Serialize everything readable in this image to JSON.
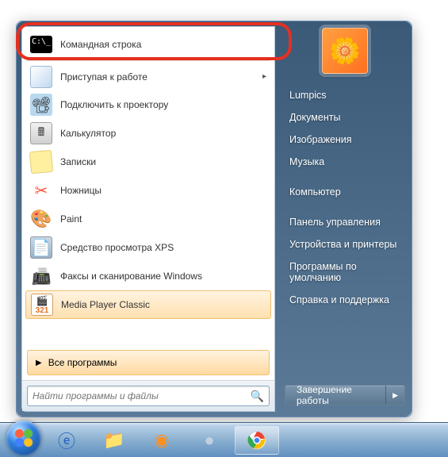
{
  "programs": [
    {
      "label": "Командная строка",
      "icon": "cmd"
    },
    {
      "label": "Приступая к работе",
      "icon": "start",
      "submenu": true
    },
    {
      "label": "Подключить к проектору",
      "icon": "proj"
    },
    {
      "label": "Калькулятор",
      "icon": "calc"
    },
    {
      "label": "Записки",
      "icon": "notes"
    },
    {
      "label": "Ножницы",
      "icon": "snip"
    },
    {
      "label": "Paint",
      "icon": "paint"
    },
    {
      "label": "Средство просмотра XPS",
      "icon": "xps"
    },
    {
      "label": "Факсы и сканирование Windows",
      "icon": "fax"
    },
    {
      "label": "Media Player Classic",
      "icon": "mpc",
      "highlight": true
    }
  ],
  "all_programs_label": "Все программы",
  "search_placeholder": "Найти программы и файлы",
  "right_links": [
    {
      "label": "Lumpics"
    },
    {
      "label": "Документы"
    },
    {
      "label": "Изображения"
    },
    {
      "label": "Музыка"
    },
    {
      "label": "Компьютер",
      "sep": true
    },
    {
      "label": "Панель управления",
      "sep": true
    },
    {
      "label": "Устройства и принтеры"
    },
    {
      "label": "Программы по умолчанию"
    },
    {
      "label": "Справка и поддержка"
    }
  ],
  "shutdown_label": "Завершение работы",
  "icon_glyphs": {
    "cmd": "C:\\_",
    "start": "",
    "proj": "📽",
    "calc": "🖩",
    "notes": "",
    "snip": "✂",
    "paint": "🎨",
    "xps": "📄",
    "fax": "📠",
    "mpc": "321"
  },
  "taskbar": {
    "items": [
      "ie",
      "explorer",
      "wmp",
      "app",
      "chrome"
    ]
  }
}
